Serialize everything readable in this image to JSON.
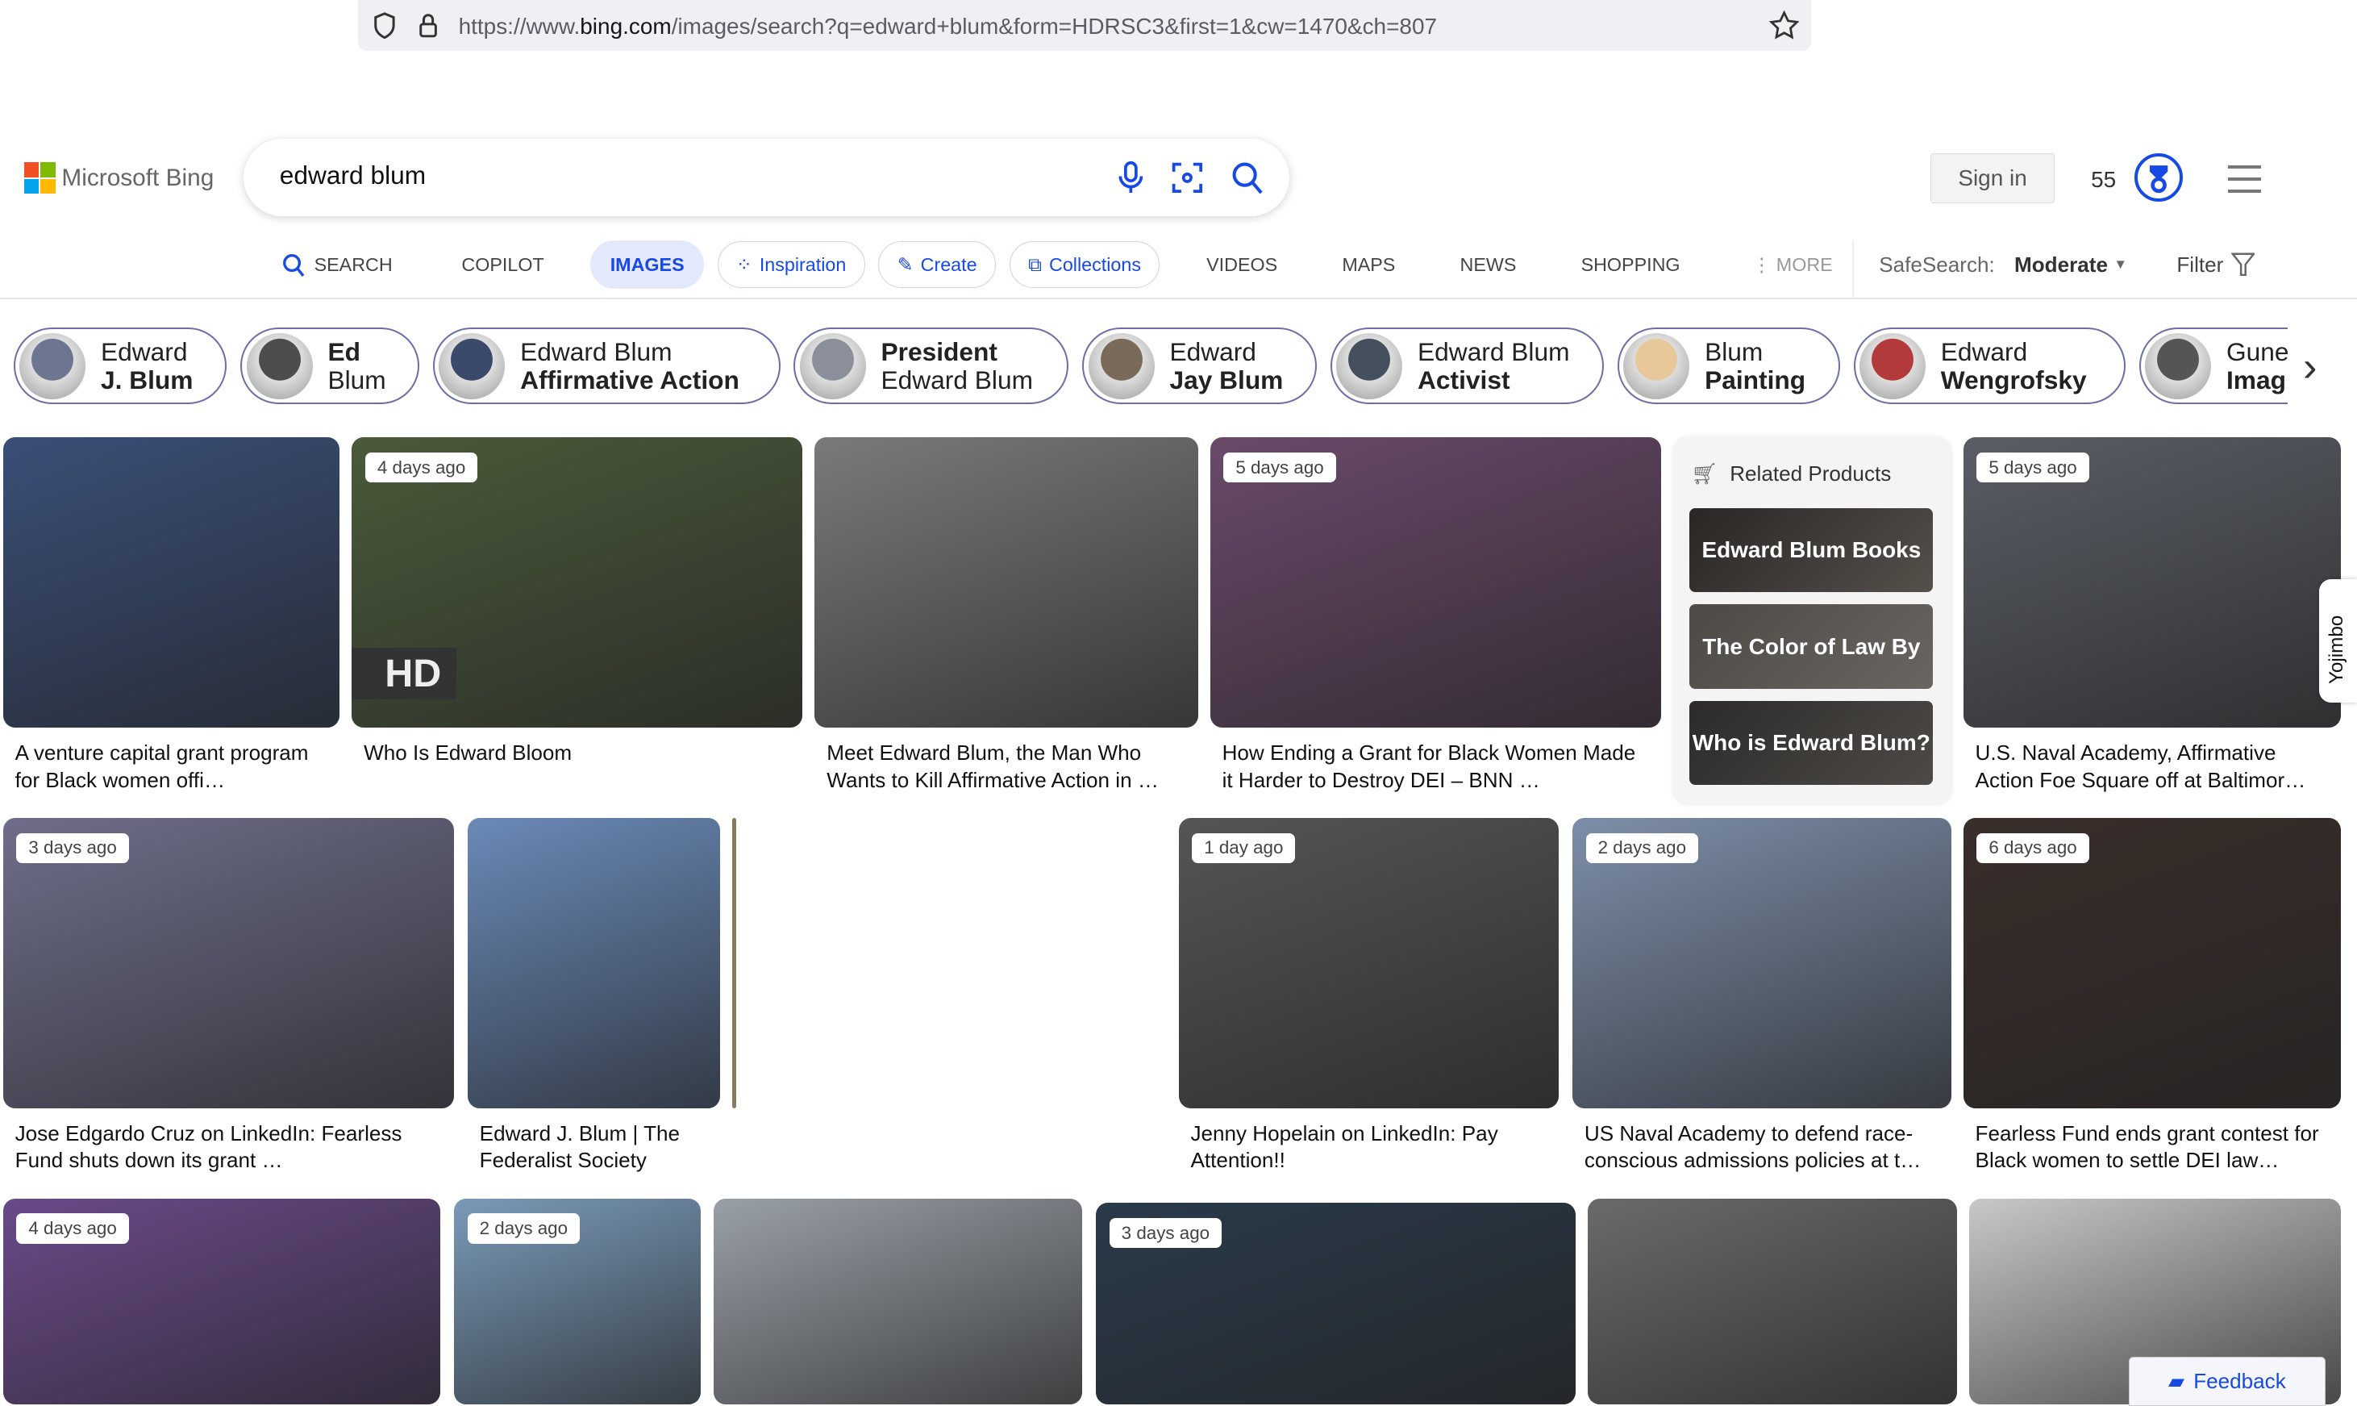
{
  "browser": {
    "url_prefix": "https://www.",
    "url_domain": "bing.com",
    "url_rest": "/images/search?q=edward+blum&form=HDRSC3&first=1&cw=1470&ch=807"
  },
  "header": {
    "logo_text": "Microsoft Bing",
    "search_value": "edward blum",
    "sign_in": "Sign in",
    "points": "55"
  },
  "nav": {
    "search": "SEARCH",
    "copilot": "COPILOT",
    "images": "IMAGES",
    "inspiration": "Inspiration",
    "create": "Create",
    "collections": "Collections",
    "videos": "VIDEOS",
    "maps": "MAPS",
    "news": "NEWS",
    "shopping": "SHOPPING",
    "more": "MORE",
    "safesearch_label": "SafeSearch:",
    "safesearch_value": "Moderate",
    "filter": "Filter"
  },
  "chips": [
    {
      "line1": "Edward",
      "line2": "J. Blum",
      "bold": 2,
      "color": "#6d7690"
    },
    {
      "line1": "Ed",
      "line2": "Blum",
      "bold": 1,
      "color": "#4d4d4d"
    },
    {
      "line1": "Edward Blum",
      "line2": "Affirmative Action",
      "bold": 2,
      "color": "#3b4a6a"
    },
    {
      "line1": "President",
      "line2": "Edward Blum",
      "bold": 1,
      "color": "#8a8f99"
    },
    {
      "line1": "Edward",
      "line2": "Jay Blum",
      "bold": 2,
      "color": "#7a6a5a"
    },
    {
      "line1": "Edward Blum",
      "line2": "Activist",
      "bold": 2,
      "color": "#45505e"
    },
    {
      "line1": "Blum",
      "line2": "Painting",
      "bold": 2,
      "color": "#e8c79a"
    },
    {
      "line1": "Edward",
      "line2": "Wengrofsky",
      "bold": 2,
      "color": "#b33a3a"
    },
    {
      "line1": "Gune",
      "line2": "Imag",
      "bold": 2,
      "color": "#555"
    }
  ],
  "results": [
    {
      "caption": "A venture capital grant program for Black women offi…",
      "badge": "",
      "color": "#3a4f78"
    },
    {
      "caption": "Who Is Edward Bloom",
      "badge": "4 days ago",
      "hd": "HD",
      "color": "#4a5a3a"
    },
    {
      "caption": "Meet Edward Blum, the Man Who Wants to Kill Affirmative Action in …",
      "badge": "",
      "color": "#7a7a7a"
    },
    {
      "caption": "How Ending a Grant for Black Women Made it Harder to Destroy DEI – BNN …",
      "badge": "5 days ago",
      "color": "#6a4a6a"
    },
    {
      "caption": "U.S. Naval Academy, Affirmative Action Foe Square off at Baltimor…",
      "badge": "5 days ago",
      "color": "#5a5e66"
    },
    {
      "caption": "Jose Edgardo Cruz on LinkedIn: Fearless Fund shuts down its grant …",
      "badge": "3 days ago",
      "color": "#6e6e8a"
    },
    {
      "caption": "Edward J. Blum | The Federalist Society",
      "badge": "",
      "color": "#6a8ab8"
    },
    {
      "caption": "Jenny Hopelain on LinkedIn: Pay Attention!!",
      "badge": "1 day ago",
      "color": "#555"
    },
    {
      "caption": "US Naval Academy to defend race-conscious admissions policies at t…",
      "badge": "2 days ago",
      "color": "#7c8ea8"
    },
    {
      "caption": "Fearless Fund ends grant contest for Black women to settle DEI law…",
      "badge": "6 days ago",
      "color": "#3a2e2a"
    },
    {
      "caption": "",
      "badge": "4 days ago",
      "color": "#6a4a8a"
    },
    {
      "caption": "",
      "badge": "2 days ago",
      "color": "#7a9ab8"
    },
    {
      "caption": "",
      "badge": "",
      "color": "#9aa0a8"
    },
    {
      "caption": "",
      "badge": "3 days ago",
      "color": "#2a3a4a"
    },
    {
      "caption": "",
      "badge": "",
      "color": "#6a6a6a"
    },
    {
      "caption": "",
      "badge": "",
      "color": "#c8c8c8"
    }
  ],
  "related_products": {
    "title": "Related Products",
    "items": [
      "Edward Blum Books",
      "The Color of Law By",
      "Who is Edward Blum?"
    ]
  },
  "side_tab": "Yojimbo",
  "feedback": "Feedback",
  "colors": {
    "accent": "#174ae4"
  }
}
